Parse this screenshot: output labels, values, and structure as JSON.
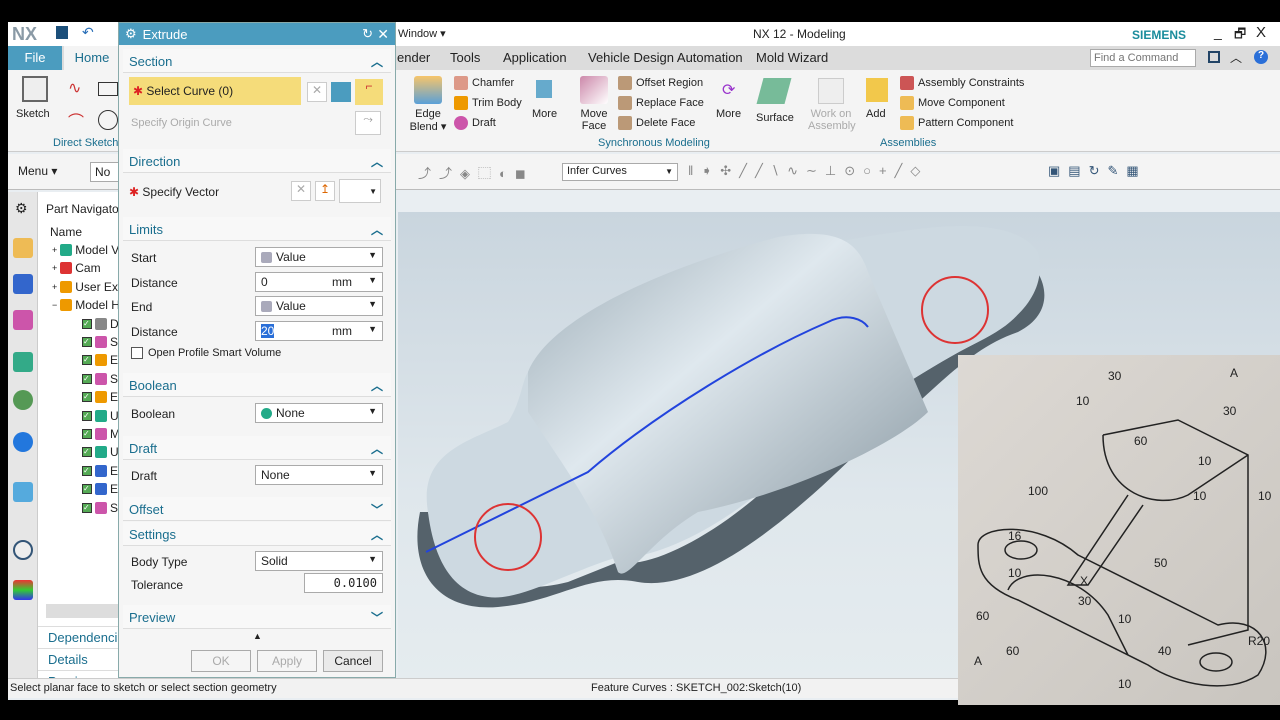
{
  "window": {
    "logo": "NX",
    "title": "NX 12 - Modeling",
    "brand": "SIEMENS",
    "window_menu": "Window ▾",
    "min": "_",
    "restore": "🗗",
    "close": "X"
  },
  "tabs": [
    "File",
    "Home",
    "ender",
    "Tools",
    "Application",
    "Vehicle Design Automation",
    "Mold Wizard"
  ],
  "find_command_placeholder": "Find a Command",
  "ribbon": {
    "sketch": "Sketch",
    "direct_sketch": "Direct Sketch",
    "edge_blend": "Edge Blend ▾",
    "chamfer": "Chamfer",
    "trim_body": "Trim Body",
    "draft": "Draft",
    "more1": "More",
    "move_face": "Move Face",
    "offset_region": "Offset Region",
    "replace_face": "Replace Face",
    "delete_face": "Delete Face",
    "more2": "More",
    "sync_group": "Synchronous Modeling",
    "surface": "Surface",
    "work_on_assembly": "Work on Assembly",
    "add": "Add",
    "assembly_constraints": "Assembly Constraints",
    "move_component": "Move Component",
    "pattern_component": "Pattern Component",
    "assemblies_group": "Assemblies"
  },
  "toolbar": {
    "menu": "Menu ▾",
    "selection_filter": "No S",
    "curve_rule": "Infer Curves"
  },
  "navigator": {
    "title": "Part Navigator",
    "column": "Name",
    "items": [
      "Model V",
      "Cam",
      "User Exp",
      "Model H",
      "D",
      "S",
      "E",
      "S",
      "E",
      "U",
      "M",
      "U",
      "E",
      "E",
      "S"
    ],
    "panels": [
      "Dependenci",
      "Details",
      "Preview"
    ]
  },
  "dialog": {
    "title": "Extrude",
    "section": {
      "header": "Section",
      "select_curve": "Select Curve (0)",
      "origin_curve": "Specify Origin Curve"
    },
    "direction": {
      "header": "Direction",
      "specify_vector": "Specify Vector"
    },
    "limits": {
      "header": "Limits",
      "start_label": "Start",
      "start_value": "Value",
      "distance1_label": "Distance",
      "distance1": "0",
      "unit1": "mm",
      "end_label": "End",
      "end_value": "Value",
      "distance2_label": "Distance",
      "distance2": "20",
      "unit2": "mm",
      "open_profile": "Open Profile Smart Volume",
      "open_profile_checked": false
    },
    "boolean": {
      "header": "Boolean",
      "label": "Boolean",
      "value": "None"
    },
    "draft": {
      "header": "Draft",
      "label": "Draft",
      "value": "None"
    },
    "offset": {
      "header": "Offset"
    },
    "settings": {
      "header": "Settings",
      "body_type_label": "Body Type",
      "body_type": "Solid",
      "tolerance_label": "Tolerance",
      "tolerance": "0.0100"
    },
    "preview": {
      "header": "Preview"
    },
    "ok": "OK",
    "apply": "Apply",
    "cancel": "Cancel"
  },
  "status": {
    "prompt": "Select planar face to sketch or select section geometry",
    "info": "Feature Curves : SKETCH_002:Sketch(10)"
  },
  "reference_drawing": {
    "dims": [
      "30",
      "10",
      "A",
      "30",
      "60",
      "10",
      "100",
      "10",
      "16",
      "10",
      "50",
      "10",
      "60",
      "30",
      "10",
      "60",
      "40",
      "R20",
      "10",
      "A",
      "X"
    ]
  },
  "colors": {
    "accent": "#4b9cbf",
    "highlight": "#f5dc7a",
    "sketch_curve": "#2244dd",
    "circle": "#d33"
  }
}
